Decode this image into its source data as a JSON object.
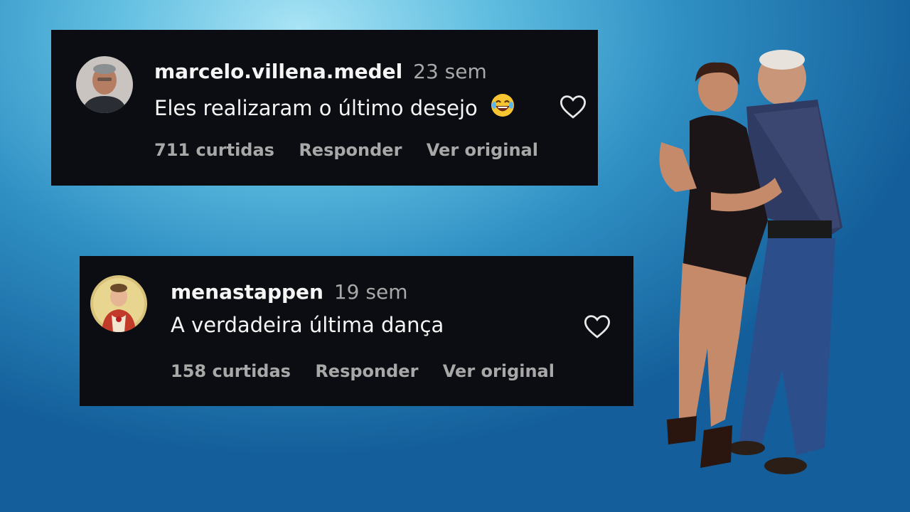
{
  "comments": [
    {
      "username": "marcelo.villena.medel",
      "time": "23 sem",
      "text": "Eles realizaram o último desejo",
      "emoji": "tears-of-joy-emoji",
      "likes": "711 curtidas",
      "reply": "Responder",
      "original": "Ver original"
    },
    {
      "username": "menastappen",
      "time": "19 sem",
      "text": "A verdadeira última dança",
      "likes": "158 curtidas",
      "reply": "Responder",
      "original": "Ver original"
    }
  ],
  "icons": {
    "like": "heart-outline-icon"
  },
  "colors": {
    "card_bg": "#0b0d12",
    "muted_text": "#a8a8a8",
    "text": "#f5f5f5"
  }
}
